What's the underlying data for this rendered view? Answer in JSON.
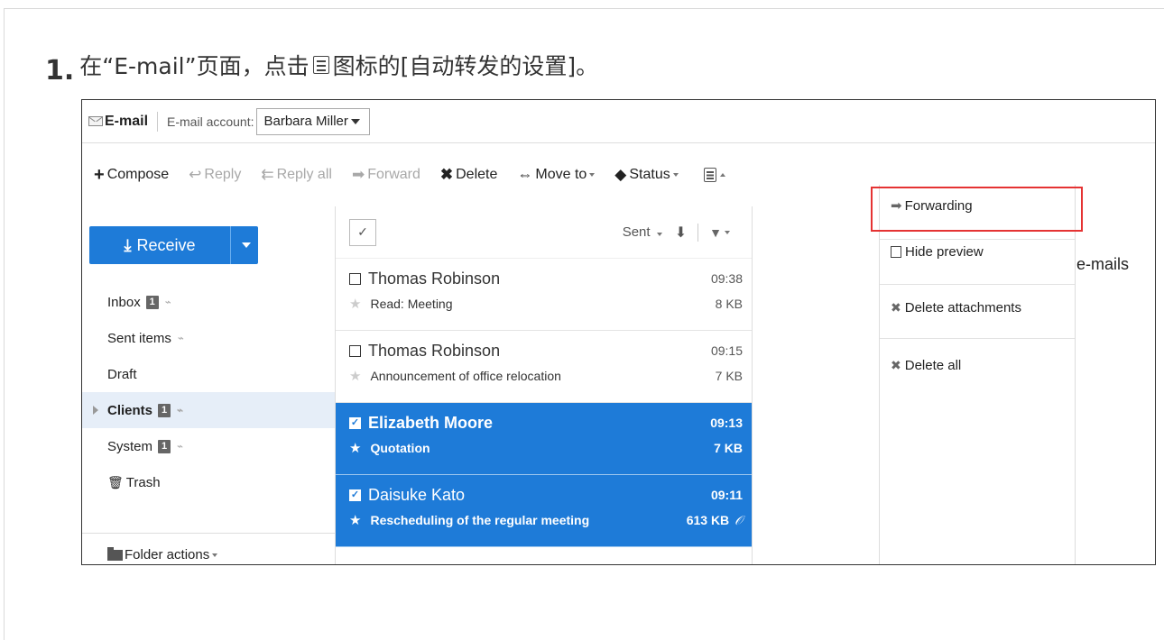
{
  "instruction": {
    "number": "1.",
    "before_icon": "在“E-mail”页面，点击",
    "after_icon": "图标的[自动转发的设置]。"
  },
  "header": {
    "app_title": "E-mail",
    "account_label": "E-mail account:",
    "account_value": "Barbara Miller"
  },
  "toolbar": {
    "compose": "Compose",
    "reply": "Reply",
    "reply_all": "Reply all",
    "forward": "Forward",
    "delete": "Delete",
    "move_to": "Move to",
    "status": "Status"
  },
  "sidebar": {
    "receive_label": "Receive",
    "folders": [
      {
        "name": "Inbox",
        "badge": "1"
      },
      {
        "name": "Sent items"
      },
      {
        "name": "Draft"
      },
      {
        "name": "Clients",
        "badge": "1"
      },
      {
        "name": "System",
        "badge": "1"
      },
      {
        "name": "Trash"
      }
    ],
    "folder_actions": "Folder actions"
  },
  "message_list": {
    "sort_label": "Sent",
    "messages": [
      {
        "sender": "Thomas Robinson",
        "time": "09:38",
        "subject": "Read: Meeting",
        "size": "8 KB"
      },
      {
        "sender": "Thomas Robinson",
        "time": "09:15",
        "subject": "Announcement of office relocation",
        "size": "7 KB"
      },
      {
        "sender": "Elizabeth Moore",
        "time": "09:13",
        "subject": "Quotation",
        "size": "7 KB"
      },
      {
        "sender": "Daisuke Kato",
        "time": "09:11",
        "subject": "Rescheduling of the regular meeting",
        "size": "613 KB"
      }
    ]
  },
  "dropdown": {
    "forwarding": "Forwarding",
    "hide_preview": "Hide preview",
    "delete_attachments": "Delete attachments",
    "delete_all": "Delete all"
  },
  "preview": {
    "partial_text": "e-mails"
  },
  "colors": {
    "accent": "#1e7bd8",
    "highlight_box": "#e53333"
  }
}
